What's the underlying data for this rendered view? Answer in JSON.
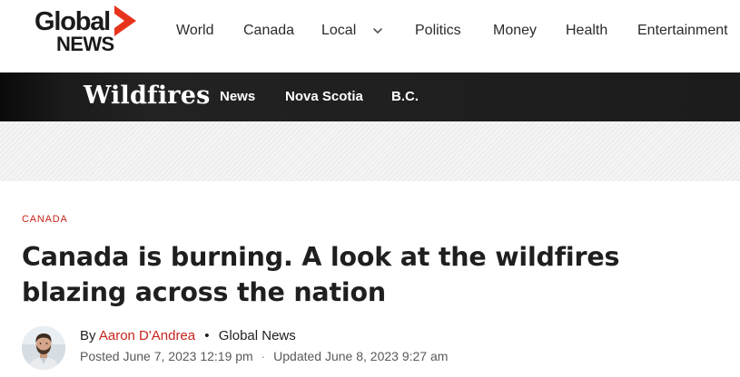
{
  "site": {
    "logo_line1": "Global",
    "logo_line2": "NEWS",
    "brand_color": "#e8331c"
  },
  "nav": {
    "items": [
      {
        "label": "World"
      },
      {
        "label": "Canada"
      },
      {
        "label": "Local",
        "has_dropdown": true,
        "dropdown_icon": "chevron-down-icon"
      },
      {
        "label": "Politics"
      },
      {
        "label": "Money"
      },
      {
        "label": "Health"
      },
      {
        "label": "Entertainment"
      }
    ]
  },
  "section_bar": {
    "title": "Wildfires",
    "links": [
      {
        "label": "News"
      },
      {
        "label": "Nova Scotia"
      },
      {
        "label": "B.C."
      }
    ],
    "background": "#1c1c1c"
  },
  "article": {
    "kicker": "CANADA",
    "kicker_color": "#c8241c",
    "headline": "Canada is burning. A look at the wildfires blazing across the nation",
    "byline": {
      "prefix": "By",
      "author": "Aaron D'Andrea",
      "separator": "•",
      "outlet": "Global News"
    },
    "posted": "Posted June 7, 2023 12:19 pm",
    "date_separator": "·",
    "updated": "Updated June 8, 2023 9:27 am"
  }
}
